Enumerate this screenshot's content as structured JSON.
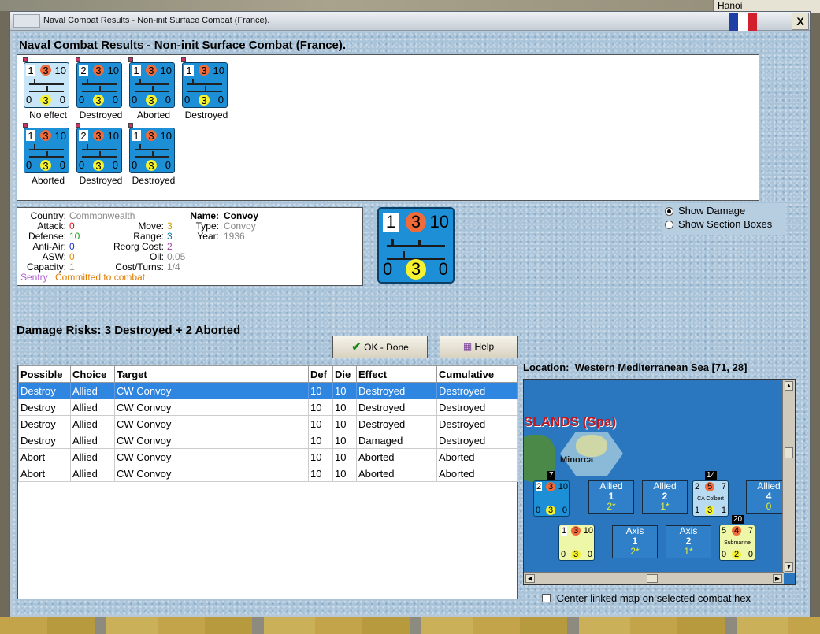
{
  "desktop": {
    "corner_label": "Hanoi"
  },
  "window": {
    "title": "Naval Combat Results - Non-init Surface Combat (France).",
    "close_label": "X"
  },
  "heading": "Naval Combat Results - Non-init Surface Combat (France).",
  "units": [
    {
      "top_left": "1",
      "attack": "3",
      "top_right": "10",
      "bottom_left": "0",
      "bottom_mid": "3",
      "bottom_right": "0",
      "caption": "No effect",
      "selected": true
    },
    {
      "top_left": "2",
      "attack": "3",
      "top_right": "10",
      "bottom_left": "0",
      "bottom_mid": "3",
      "bottom_right": "0",
      "caption": "Destroyed"
    },
    {
      "top_left": "1",
      "attack": "3",
      "top_right": "10",
      "bottom_left": "0",
      "bottom_mid": "3",
      "bottom_right": "0",
      "caption": "Aborted"
    },
    {
      "top_left": "1",
      "attack": "3",
      "top_right": "10",
      "bottom_left": "0",
      "bottom_mid": "3",
      "bottom_right": "0",
      "caption": "Destroyed"
    },
    {
      "top_left": "1",
      "attack": "3",
      "top_right": "10",
      "bottom_left": "0",
      "bottom_mid": "3",
      "bottom_right": "0",
      "caption": "Aborted"
    },
    {
      "top_left": "2",
      "attack": "3",
      "top_right": "10",
      "bottom_left": "0",
      "bottom_mid": "3",
      "bottom_right": "0",
      "caption": "Destroyed"
    },
    {
      "top_left": "1",
      "attack": "3",
      "top_right": "10",
      "bottom_left": "0",
      "bottom_mid": "3",
      "bottom_right": "0",
      "caption": "Destroyed"
    }
  ],
  "info": {
    "country_label": "Country:",
    "country": "Commonwealth",
    "attack_label": "Attack:",
    "attack": "0",
    "defense_label": "Defense:",
    "defense": "10",
    "antiair_label": "Anti-Air:",
    "antiair": "0",
    "asw_label": "ASW:",
    "asw": "0",
    "capacity_label": "Capacity:",
    "capacity": "1",
    "sentry": "Sentry",
    "status": "Committed to combat",
    "move_label": "Move:",
    "move": "3",
    "range_label": "Range:",
    "range": "3",
    "reorg_label": "Reorg Cost:",
    "reorg": "2",
    "oil_label": "Oil:",
    "oil": "0.05",
    "cost_label": "Cost/Turns:",
    "cost": "1/4",
    "name_label": "Name:",
    "name": "Convoy",
    "type_label": "Type:",
    "type": "Convoy",
    "year_label": "Year:",
    "year": "1936"
  },
  "big_counter": {
    "top_left": "1",
    "attack": "3",
    "top_right": "10",
    "bottom_left": "0",
    "bottom_mid": "3",
    "bottom_right": "0"
  },
  "options": {
    "show_damage": "Show Damage",
    "show_section_boxes": "Show Section Boxes",
    "center_linked": "Center linked map on selected combat hex"
  },
  "damage_risks": "Damage Risks: 3 Destroyed + 2 Aborted",
  "buttons": {
    "ok": "OK - Done",
    "help": "Help"
  },
  "table": {
    "headers": [
      "Possible",
      "Choice",
      "Target",
      "Def",
      "Die",
      "Effect",
      "Cumulative"
    ],
    "rows": [
      [
        "Destroy",
        "Allied",
        "CW Convoy",
        "10",
        "10",
        "Destroyed",
        "Destroyed"
      ],
      [
        "Destroy",
        "Allied",
        "CW Convoy",
        "10",
        "10",
        "Destroyed",
        "Destroyed"
      ],
      [
        "Destroy",
        "Allied",
        "CW Convoy",
        "10",
        "10",
        "Destroyed",
        "Destroyed"
      ],
      [
        "Destroy",
        "Allied",
        "CW Convoy",
        "10",
        "10",
        "Damaged",
        "Destroyed"
      ],
      [
        "Abort",
        "Allied",
        "CW Convoy",
        "10",
        "10",
        "Aborted",
        "Aborted"
      ],
      [
        "Abort",
        "Allied",
        "CW Convoy",
        "10",
        "10",
        "Aborted",
        "Aborted"
      ]
    ]
  },
  "location": {
    "label": "Location:",
    "value": "Western Mediterranean Sea [71, 28]"
  },
  "map": {
    "region_label": "SLANDS (Spa)",
    "island_label": "Minorca",
    "boxes": [
      {
        "side": "Allied",
        "num": "1",
        "sub": "2*"
      },
      {
        "side": "Allied",
        "num": "2",
        "sub": "1*"
      },
      {
        "side": "Allied",
        "num": "4",
        "sub": "0"
      },
      {
        "side": "Axis",
        "num": "1",
        "sub": "2*"
      },
      {
        "side": "Axis",
        "num": "2",
        "sub": "1*"
      }
    ],
    "stack_counts": [
      "7",
      "14",
      "20"
    ],
    "colbert": {
      "tl": "2",
      "att": "5",
      "tr": "7",
      "name": "CA Colbert",
      "bl": "1",
      "bm": "3",
      "br": "1"
    },
    "convoy_top": {
      "tl": "2",
      "att": "3",
      "tr": "10",
      "bl": "0",
      "bm": "3",
      "br": "0"
    },
    "convoy_bot": {
      "tl": "1",
      "att": "3",
      "tr": "10",
      "bl": "0",
      "bm": "3",
      "br": "0"
    },
    "submarine": {
      "tl": "5",
      "att": "4",
      "tr": "7",
      "name": "Submarine",
      "bl": "0",
      "bm": "2",
      "br": "0"
    }
  },
  "colors": {
    "accent": "#2f86e0",
    "counter_blue": "#1d8fd6",
    "attack_red": "#ef6b3a",
    "defense_green": "#119a11"
  }
}
